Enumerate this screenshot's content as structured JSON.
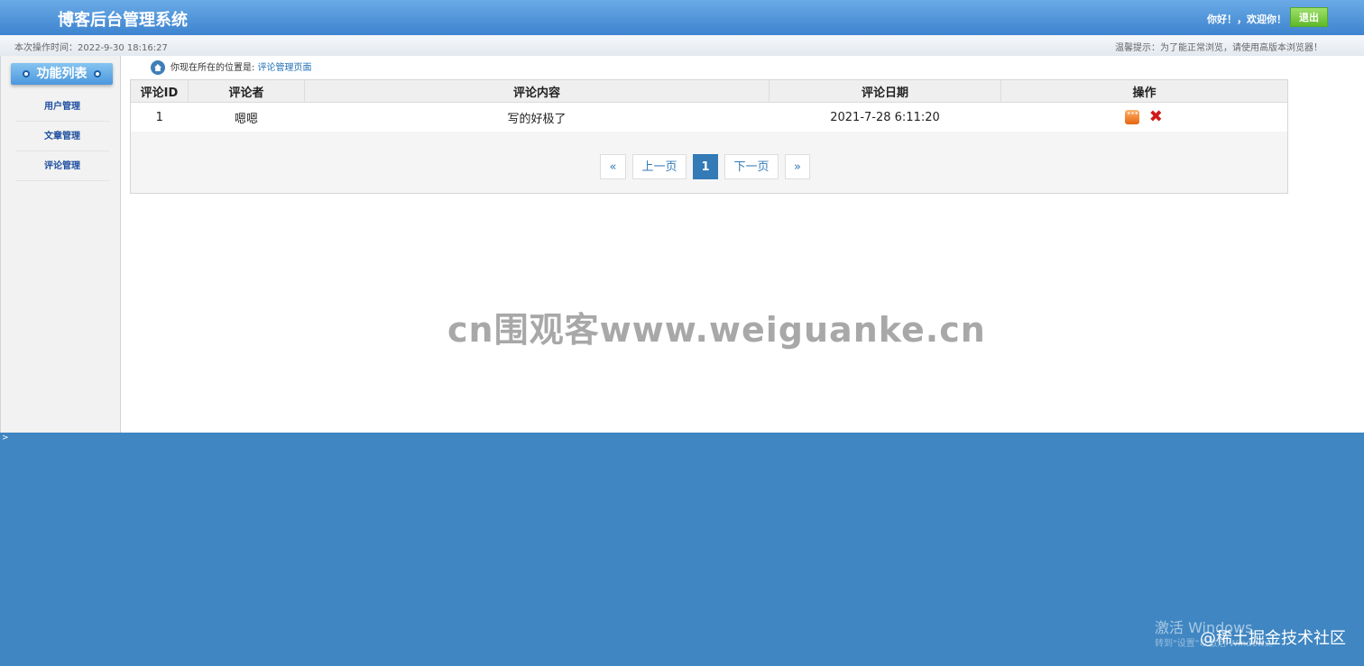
{
  "header": {
    "title": "博客后台管理系统",
    "greeting": "你好！，欢迎你！",
    "logout_label": "退出"
  },
  "subbar": {
    "last_op_time": "本次操作时间：2022-9-30 18:16:27",
    "tip": "温馨提示：为了能正常浏览，请使用高版本浏览器！"
  },
  "sidebar": {
    "heading": "功能列表",
    "items": [
      {
        "label": "用户管理"
      },
      {
        "label": "文章管理"
      },
      {
        "label": "评论管理"
      }
    ]
  },
  "breadcrumb": {
    "prefix": "你现在所在的位置是:",
    "current": "评论管理页面"
  },
  "table": {
    "headers": [
      "评论ID",
      "评论者",
      "评论内容",
      "评论日期",
      "操作"
    ],
    "rows": [
      {
        "id": "1",
        "author": "嗯嗯",
        "content": "写的好极了",
        "date": "2021-7-28 6:11:20"
      }
    ],
    "actions": [
      "reply-icon",
      "delete-icon"
    ]
  },
  "pagination": {
    "first": "«",
    "prev": "上一页",
    "current": "1",
    "next": "下一页",
    "last": "»"
  },
  "overlays": {
    "watermark": "cn围观客www.weiguanke.cn",
    "windows_activate": "激活 Windows",
    "windows_hint": "转到\"设置\"以激活 Windows。",
    "juejin": "@稀土掘金技术社区",
    "corner_arrow": ">"
  }
}
